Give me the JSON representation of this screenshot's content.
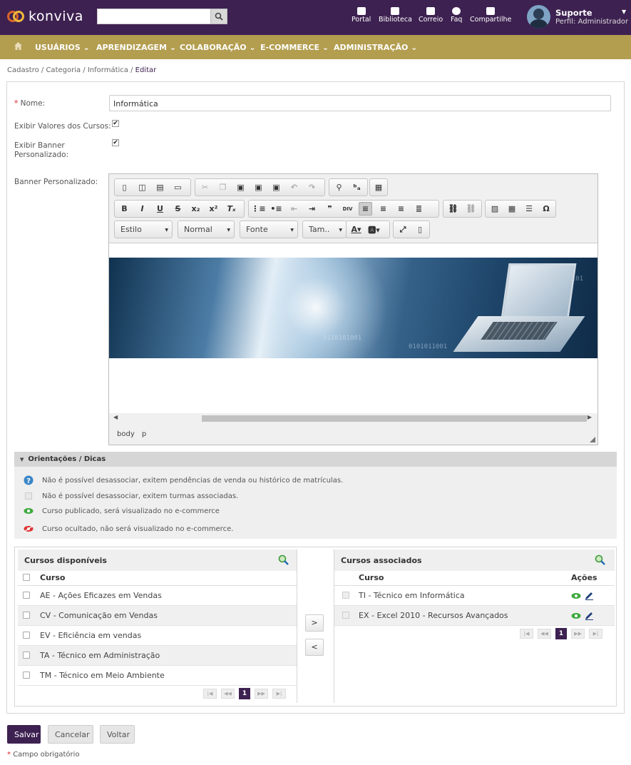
{
  "header": {
    "logo_text": "konviva",
    "search_placeholder": "",
    "links": [
      {
        "label": "Portal",
        "icon": "portal-icon"
      },
      {
        "label": "Biblioteca",
        "icon": "folder-icon"
      },
      {
        "label": "Correio",
        "icon": "mail-icon"
      },
      {
        "label": "Faq",
        "icon": "question-icon"
      },
      {
        "label": "Compartilhe",
        "icon": "share-icon"
      }
    ],
    "user": {
      "name": "Suporte",
      "profile": "Perfil: Administrador"
    }
  },
  "nav": {
    "items": [
      "USUÁRIOS",
      "APRENDIZAGEM",
      "COLABORAÇÃO",
      "E-COMMERCE",
      "ADMINISTRAÇÃO"
    ]
  },
  "breadcrumb": {
    "trail": "Cadastro / Categoria / Informática / ",
    "current": "Editar"
  },
  "form": {
    "name_label": "Nome:",
    "name_value": "Informática",
    "show_values_label": "Exibir Valores dos Cursos:",
    "show_banner_label_1": "Exibir Banner",
    "show_banner_label_2": "Personalizado:",
    "banner_label": "Banner Personalizado:",
    "show_values_checked": true,
    "show_banner_checked": true
  },
  "editor": {
    "combos": {
      "style": "Estilo",
      "format": "Normal",
      "font": "Fonte",
      "size": "Tam.."
    },
    "path": [
      "body",
      "p"
    ],
    "binary_text": [
      "0110101001",
      "100100010101",
      "0101011001"
    ]
  },
  "tips": {
    "title": "Orientações / Dicas",
    "rows": [
      {
        "icon": "info-icon",
        "text": "Não é possível desassociar, exitem pendências de venda ou histórico de matrículas."
      },
      {
        "icon": "disabled-checkbox-icon",
        "text": "Não é possível desassociar, exitem turmas associadas."
      },
      {
        "icon": "eye-visible-icon",
        "text": "Curso publicado, será visualizado no e-commerce"
      },
      {
        "icon": "eye-hidden-icon",
        "text": "Curso ocultado, não será visualizado no e-commerce."
      }
    ]
  },
  "courses": {
    "available": {
      "title": "Cursos disponíveis",
      "col_course": "Curso",
      "rows": [
        "AE - Ações Eficazes em Vendas",
        "CV - Comunicação em Vendas",
        "EV - Eficiência em vendas",
        "TA - Técnico em Administração",
        "TM - Técnico em Meio Ambiente"
      ],
      "page": "1"
    },
    "associated": {
      "title": "Cursos associados",
      "col_course": "Curso",
      "col_actions": "Ações",
      "rows": [
        "TI - Técnico em Informática",
        "EX - Excel 2010 - Recursos Avançados"
      ],
      "page": "1"
    },
    "move_right": ">",
    "move_left": "<"
  },
  "buttons": {
    "save": "Salvar",
    "cancel": "Cancelar",
    "back": "Voltar"
  },
  "footnote": "Campo obrigatório",
  "colors": {
    "primary": "#3d2151",
    "nav": "#b39d4f"
  }
}
